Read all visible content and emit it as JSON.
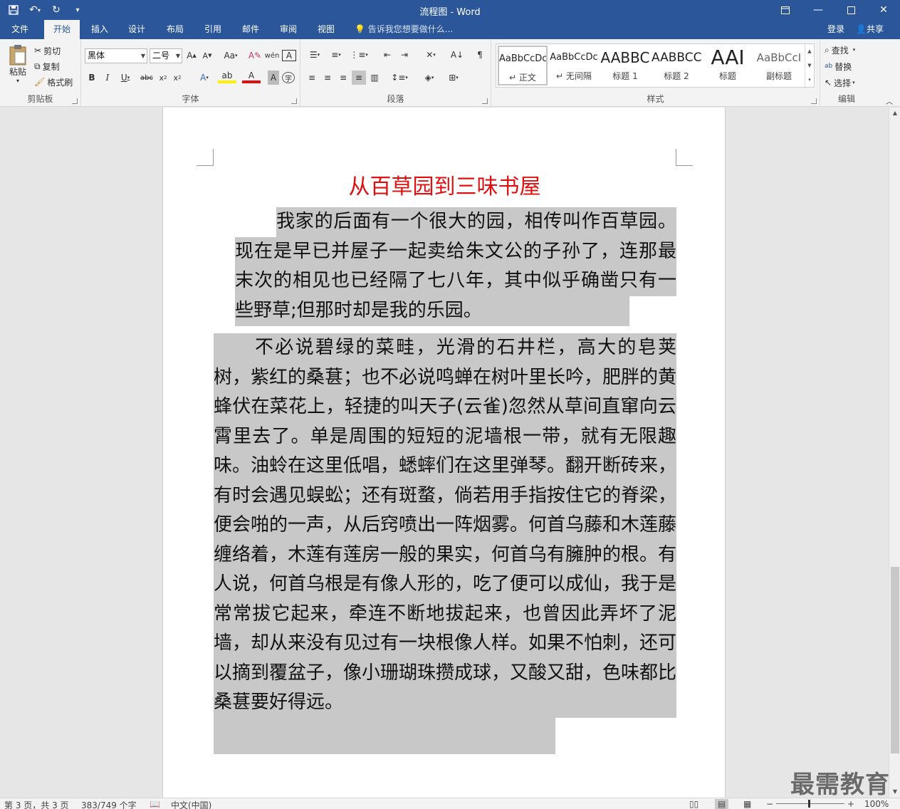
{
  "app": {
    "window_title": "流程图 - Word"
  },
  "tabs": [
    {
      "label": "文件"
    },
    {
      "label": "开始"
    },
    {
      "label": "插入"
    },
    {
      "label": "设计"
    },
    {
      "label": "布局"
    },
    {
      "label": "引用"
    },
    {
      "label": "邮件"
    },
    {
      "label": "审阅"
    },
    {
      "label": "视图"
    }
  ],
  "tell_me": "告诉我您想要做什么...",
  "account": {
    "login": "登录",
    "share": "共享"
  },
  "clipboard": {
    "paste": "粘贴",
    "cut": "剪切",
    "copy": "复制",
    "format_painter": "格式刷",
    "group": "剪贴板"
  },
  "font": {
    "name": "黑体",
    "size": "二号",
    "change_case": "Aa",
    "group": "字体"
  },
  "paragraph": {
    "group": "段落"
  },
  "styles": {
    "group": "样式",
    "items": [
      {
        "sample": "AaBbCcDc",
        "name": "正文"
      },
      {
        "sample": "AaBbCcDc",
        "name": "无间隔"
      },
      {
        "sample": "AABBC",
        "name": "标题 1"
      },
      {
        "sample": "AABBCC",
        "name": "标题 2"
      },
      {
        "sample": "AAI",
        "name": "标题"
      },
      {
        "sample": "AaBbCcI",
        "name": "副标题"
      }
    ]
  },
  "editing": {
    "find": "查找",
    "replace": "替换",
    "select": "选择",
    "group": "编辑"
  },
  "document": {
    "title": "从百草园到三味书屋",
    "paragraphs": [
      "我家的后面有一个很大的园，相传叫作百草园。现在是早已并屋子一起卖给朱文公的子孙了，连那最末次的相见也已经隔了七八年，其中似乎确凿只有一些野草;但那时却是我的乐园。",
      "不必说碧绿的菜畦，光滑的石井栏，高大的皂荚树，紫红的桑葚；也不必说鸣蝉在树叶里长吟，肥胖的黄蜂伏在菜花上，轻捷的叫天子(云雀)忽然从草间直窜向云霄里去了。单是周围的短短的泥墙根一带，就有无限趣味。油蛉在这里低唱，蟋蟀们在这里弹琴。翻开断砖来，有时会遇见蜈蚣；还有斑蝥，倘若用手指按住它的脊梁，便会啪的一声，从后窍喷出一阵烟雾。何首乌藤和木莲藤缠络着，木莲有莲房一般的果实，何首乌有臃肿的根。有人说，何首乌根是有像人形的，吃了便可以成仙，我于是常常拔它起来，牵连不断地拔起来，也曾因此弄坏了泥墙，却从来没有见过有一块根像人样。如果不怕刺，还可以摘到覆盆子，像小珊瑚珠攒成球，又酸又甜，色味都比桑葚要好得远。"
    ]
  },
  "status": {
    "page": "第 3 页，共 3 页",
    "words": "383/749 个字",
    "language": "中文(中国)",
    "zoom": "100%"
  },
  "watermark": "最需教育"
}
